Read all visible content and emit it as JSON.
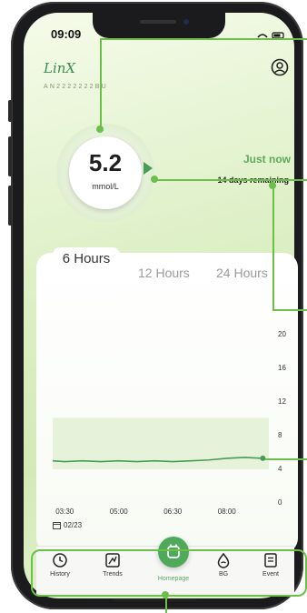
{
  "status": {
    "time": "09:09"
  },
  "app": {
    "logo": "LinX",
    "serial": "AN2222222BU",
    "profile_icon": "profile-icon"
  },
  "glucose": {
    "value": "5.2",
    "unit": "mmol/L",
    "trend_icon": "trend-arrow-right",
    "updated": "Just now",
    "sensor_remaining": "14 days remaining"
  },
  "chart_tabs": {
    "active": "6 Hours",
    "tabs": [
      "6 Hours",
      "12 Hours",
      "24 Hours"
    ]
  },
  "chart_data": {
    "type": "line",
    "x_ticks": [
      "03:30",
      "05:00",
      "06:30",
      "08:00"
    ],
    "y_ticks": [
      0,
      4,
      8,
      12,
      16,
      20
    ],
    "ylim": [
      0,
      24
    ],
    "target_range": [
      3.9,
      10.0
    ],
    "date": "02/23",
    "series": [
      {
        "x": [
          "03:10",
          "03:30",
          "04:00",
          "04:30",
          "05:00",
          "05:30",
          "06:00",
          "06:30",
          "07:00",
          "07:30",
          "08:00",
          "08:30",
          "09:00"
        ],
        "values": [
          4.9,
          4.8,
          4.9,
          4.8,
          4.9,
          4.8,
          4.9,
          4.8,
          4.9,
          5.0,
          5.2,
          5.3,
          5.2
        ]
      }
    ],
    "grid": false,
    "color": "#4a9b55"
  },
  "nav": {
    "items": [
      {
        "label": "History",
        "icon": "history-icon"
      },
      {
        "label": "Trends",
        "icon": "trends-icon"
      },
      {
        "label": "Homepage",
        "icon": "home-icon"
      },
      {
        "label": "BG",
        "icon": "drop-icon"
      },
      {
        "label": "Event",
        "icon": "event-icon"
      }
    ]
  },
  "colors": {
    "accent": "#4ea95a",
    "annotation": "#6cc04a",
    "background": "#d8eec2"
  }
}
